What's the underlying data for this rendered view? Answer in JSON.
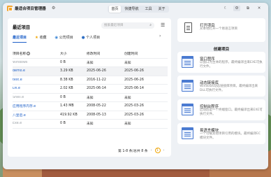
{
  "app": {
    "title": "最适合项目管理器",
    "logo_icon": "app-logo-icon",
    "settings_icon": "gear-icon"
  },
  "nav": {
    "tabs": [
      {
        "label": "首页",
        "active": true
      },
      {
        "label": "快捷导航",
        "active": false
      },
      {
        "label": "工具",
        "active": false
      },
      {
        "label": "关于",
        "active": false
      }
    ]
  },
  "window_controls": {
    "theme": "☾",
    "settings": "⚙",
    "pin": "⧉",
    "close": "✕"
  },
  "recent": {
    "title": "最近项目",
    "search_placeholder": "搜索最近项目",
    "tabs": [
      "最近项目",
      "收藏",
      "公司项目",
      "个人项目"
    ],
    "columns": [
      "项目名称",
      "大小",
      "修改时间",
      "创建时间"
    ],
    "rows": [
      {
        "name": "Windows",
        "size": "0 B",
        "modified": "未知",
        "created": "未知",
        "style": "gray"
      },
      {
        "name": "demo.e",
        "size": "3.29 KB",
        "modified": "2025-06-26",
        "created": "2025-06-26",
        "style": "blue"
      },
      {
        "name": "test.e",
        "size": "8.38 KB",
        "modified": "2016-11-22",
        "created": "2025-06-26",
        "style": "blue"
      },
      {
        "name": "DII.e",
        "size": "2.02 KB",
        "modified": "2025-06-14",
        "created": "2025-06-14",
        "style": "blue"
      },
      {
        "name": "Shell.e",
        "size": "0 B",
        "modified": "未知",
        "created": "未知",
        "style": "gray"
      },
      {
        "name": "应用程序内存.e",
        "size": "1.43 MB",
        "modified": "2008-05-22",
        "created": "2025-03-26",
        "style": "blue"
      },
      {
        "name": "八皇后.e",
        "size": "419.92 KB",
        "modified": "2008-05-13",
        "created": "2025-03-26",
        "style": "blue"
      },
      {
        "name": "Exe.e",
        "size": "0 B",
        "modified": "未知",
        "created": "未知",
        "style": "gray"
      }
    ],
    "pager": {
      "summary": "第 1-8 条/总共 8 条",
      "page": "1",
      "prev": "‹",
      "next": "›"
    }
  },
  "open_card": {
    "title": "打开项目",
    "desc": "从本地打开一个易语言项目",
    "icon": "document-icon"
  },
  "create": {
    "title": "创建项目",
    "items": [
      {
        "title": "窗口程序",
        "desc": "以窗口为主体的程序。最终编译出来EXE可执行文件。",
        "icon": "window-app-icon"
      },
      {
        "title": "动态链接库",
        "desc": "Windows动态链接库项目。最终编译出来DLL可执行文件。",
        "icon": "dll-icon"
      },
      {
        "title": "控制台程序",
        "desc": "启动后是一个终端窗口。最终编译出来EXE可执行文件。",
        "icon": "console-icon"
      },
      {
        "title": "易语言模块",
        "desc": "一个可被其他项目引用的模块。最终编译EC模块文件。",
        "icon": "module-icon"
      }
    ]
  },
  "colors": {
    "accent": "#1e60c8",
    "warning": "#f0a400",
    "panel": "#ffffff",
    "window_bg": "#eef1f5"
  }
}
